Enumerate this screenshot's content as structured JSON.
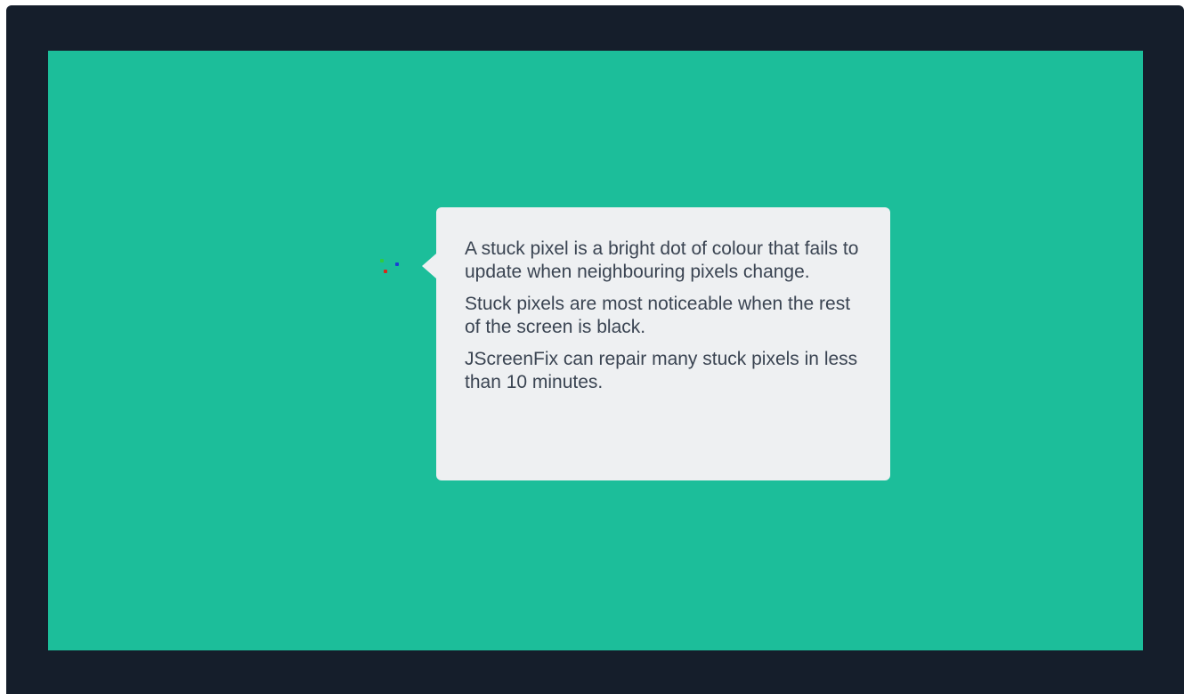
{
  "colors": {
    "frame": "#151e2b",
    "screen": "#1cbe9a",
    "tooltip_bg": "#eef0f2",
    "text": "#3a4452",
    "pixel_green": "#2ecc40",
    "pixel_blue": "#1a3fd6",
    "pixel_red": "#d62a1a"
  },
  "stuck_pixels": [
    {
      "name": "green",
      "color_key": "pixel_green"
    },
    {
      "name": "blue",
      "color_key": "pixel_blue"
    },
    {
      "name": "red",
      "color_key": "pixel_red"
    }
  ],
  "tooltip": {
    "paragraphs": [
      "A stuck pixel is a bright dot of colour that fails to update when neighbouring pixels change.",
      "Stuck pixels are most noticeable when the rest of the screen is black.",
      "JScreenFix can repair many stuck pixels in less than 10 minutes."
    ]
  }
}
